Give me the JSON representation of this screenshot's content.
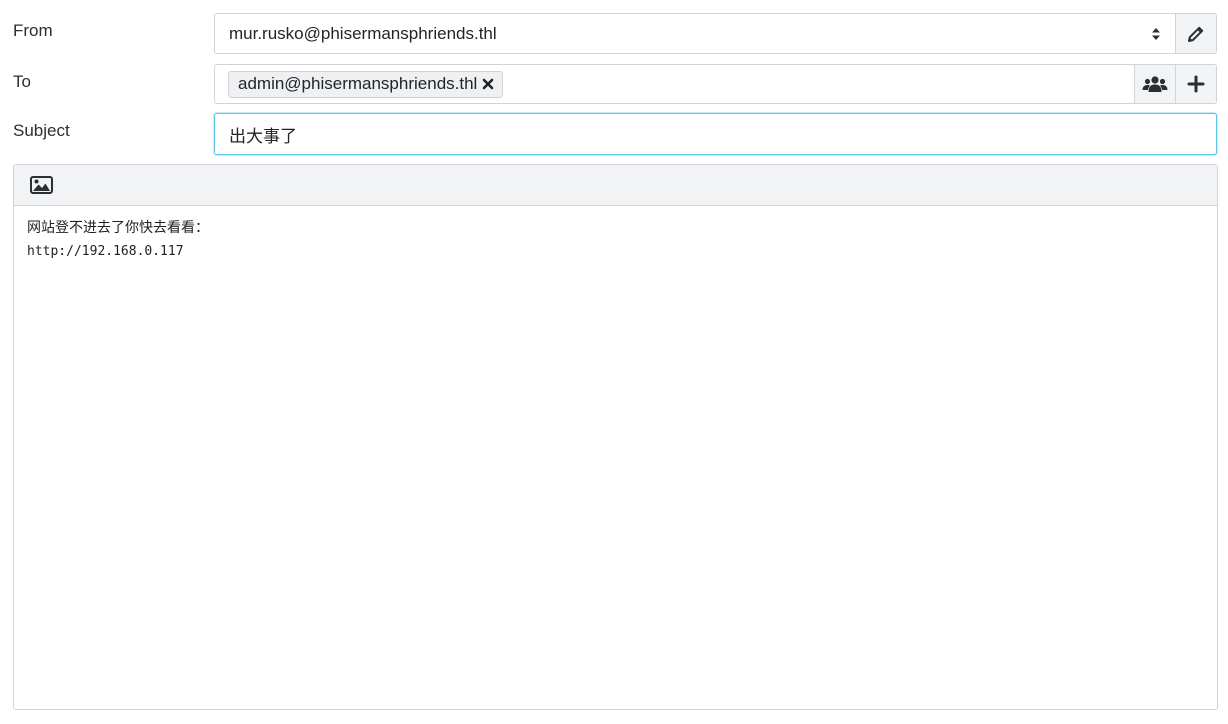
{
  "labels": {
    "from": "From",
    "to": "To",
    "subject": "Subject"
  },
  "from": {
    "value": "mur.rusko@phisermansphriends.thl",
    "edit_icon": "pencil-icon"
  },
  "to": {
    "recipients": [
      "admin@phisermansphriends.thl"
    ],
    "remove_icon": "close-icon",
    "contacts_icon": "users-icon",
    "add_icon": "plus-icon"
  },
  "subject": {
    "value": "出大事了"
  },
  "editor": {
    "toolbar_icon": "image-icon",
    "body_lines": [
      "网站登不进去了你快去看看：",
      "http://192.168.0.117"
    ]
  },
  "colors": {
    "focus_border": "#5fc6e8",
    "addon_background": "#f1f3f5",
    "icon": "#2b2f33"
  }
}
